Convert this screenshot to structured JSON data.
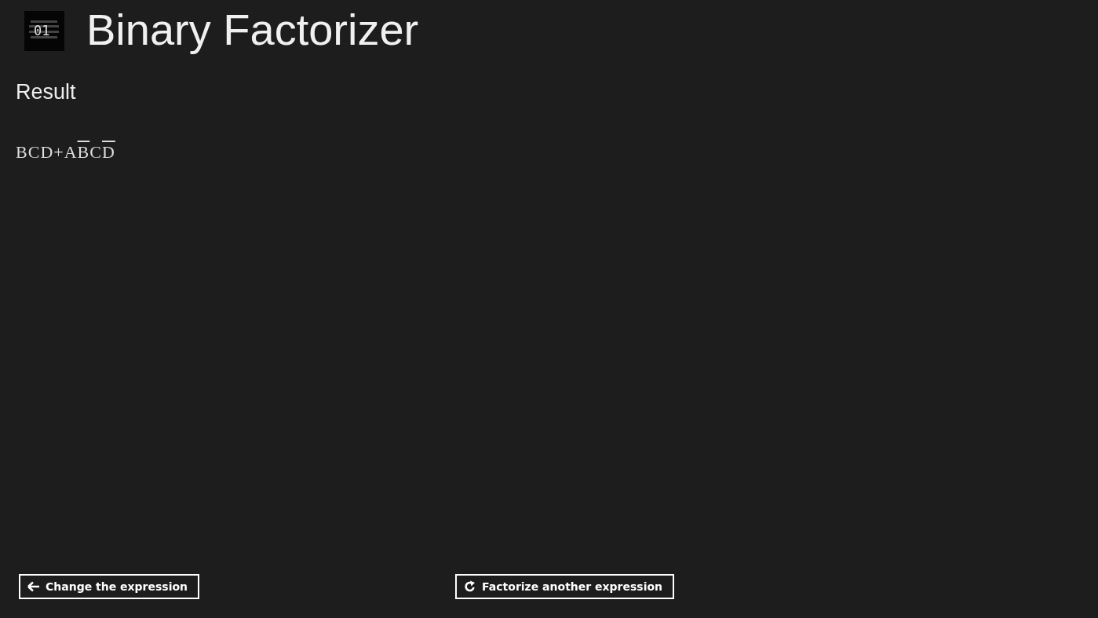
{
  "app": {
    "logo_text": "01",
    "title": "Binary Factorizer"
  },
  "result": {
    "heading": "Result",
    "expression": [
      {
        "symbol": "B",
        "negated": false
      },
      {
        "symbol": "C",
        "negated": false
      },
      {
        "symbol": "D",
        "negated": false
      },
      {
        "symbol": "+",
        "negated": false
      },
      {
        "symbol": "A",
        "negated": false
      },
      {
        "symbol": "B",
        "negated": true
      },
      {
        "symbol": "C",
        "negated": false
      },
      {
        "symbol": "D",
        "negated": true
      }
    ]
  },
  "buttons": [
    {
      "kind": "back",
      "label": "Change the expression"
    },
    {
      "kind": "refresh",
      "label": "Factorize another expression"
    }
  ]
}
